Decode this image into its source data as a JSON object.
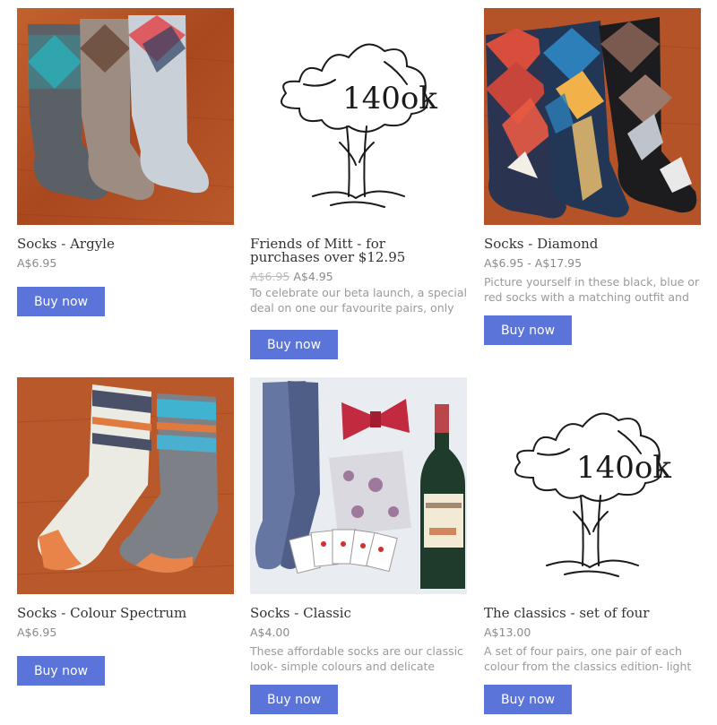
{
  "products": [
    {
      "title": "Socks - Argyle",
      "price": "A$6.95",
      "buy_label": "Buy now",
      "image": "argyle-socks-photo"
    },
    {
      "title": "Friends of Mitt - for purchases over $12.95",
      "price_old": "A$6.95",
      "price": "A$4.95",
      "description": "To celebrate our beta launch, a special deal on one our favourite pairs, only for",
      "buy_label": "Buy now",
      "image": "140ok-logo",
      "logo_text": "140ok"
    },
    {
      "title": "Socks - Diamond",
      "price": "A$6.95 - A$17.95",
      "description": "Picture yourself in these black, blue or red socks with a matching outfit and",
      "buy_label": "Buy now",
      "image": "diamond-socks-photo"
    },
    {
      "title": "Socks - Colour Spectrum",
      "price": "A$6.95",
      "buy_label": "Buy now",
      "image": "colour-spectrum-socks-photo"
    },
    {
      "title": "Socks - Classic",
      "price": "A$4.00",
      "description": "These affordable socks are our classic look- simple colours and delicate",
      "buy_label": "Buy now",
      "image": "classic-socks-bowtie-photo"
    },
    {
      "title": "The classics - set of four",
      "price": "A$13.00",
      "description": "A set of four pairs, one pair of each colour from the classics edition- light",
      "buy_label": "Buy now",
      "image": "140ok-logo",
      "logo_text": "140ok"
    }
  ],
  "colors": {
    "button": "#5a74d9",
    "wood": "#b5532a",
    "classic_bg": "#e9ecf0"
  }
}
